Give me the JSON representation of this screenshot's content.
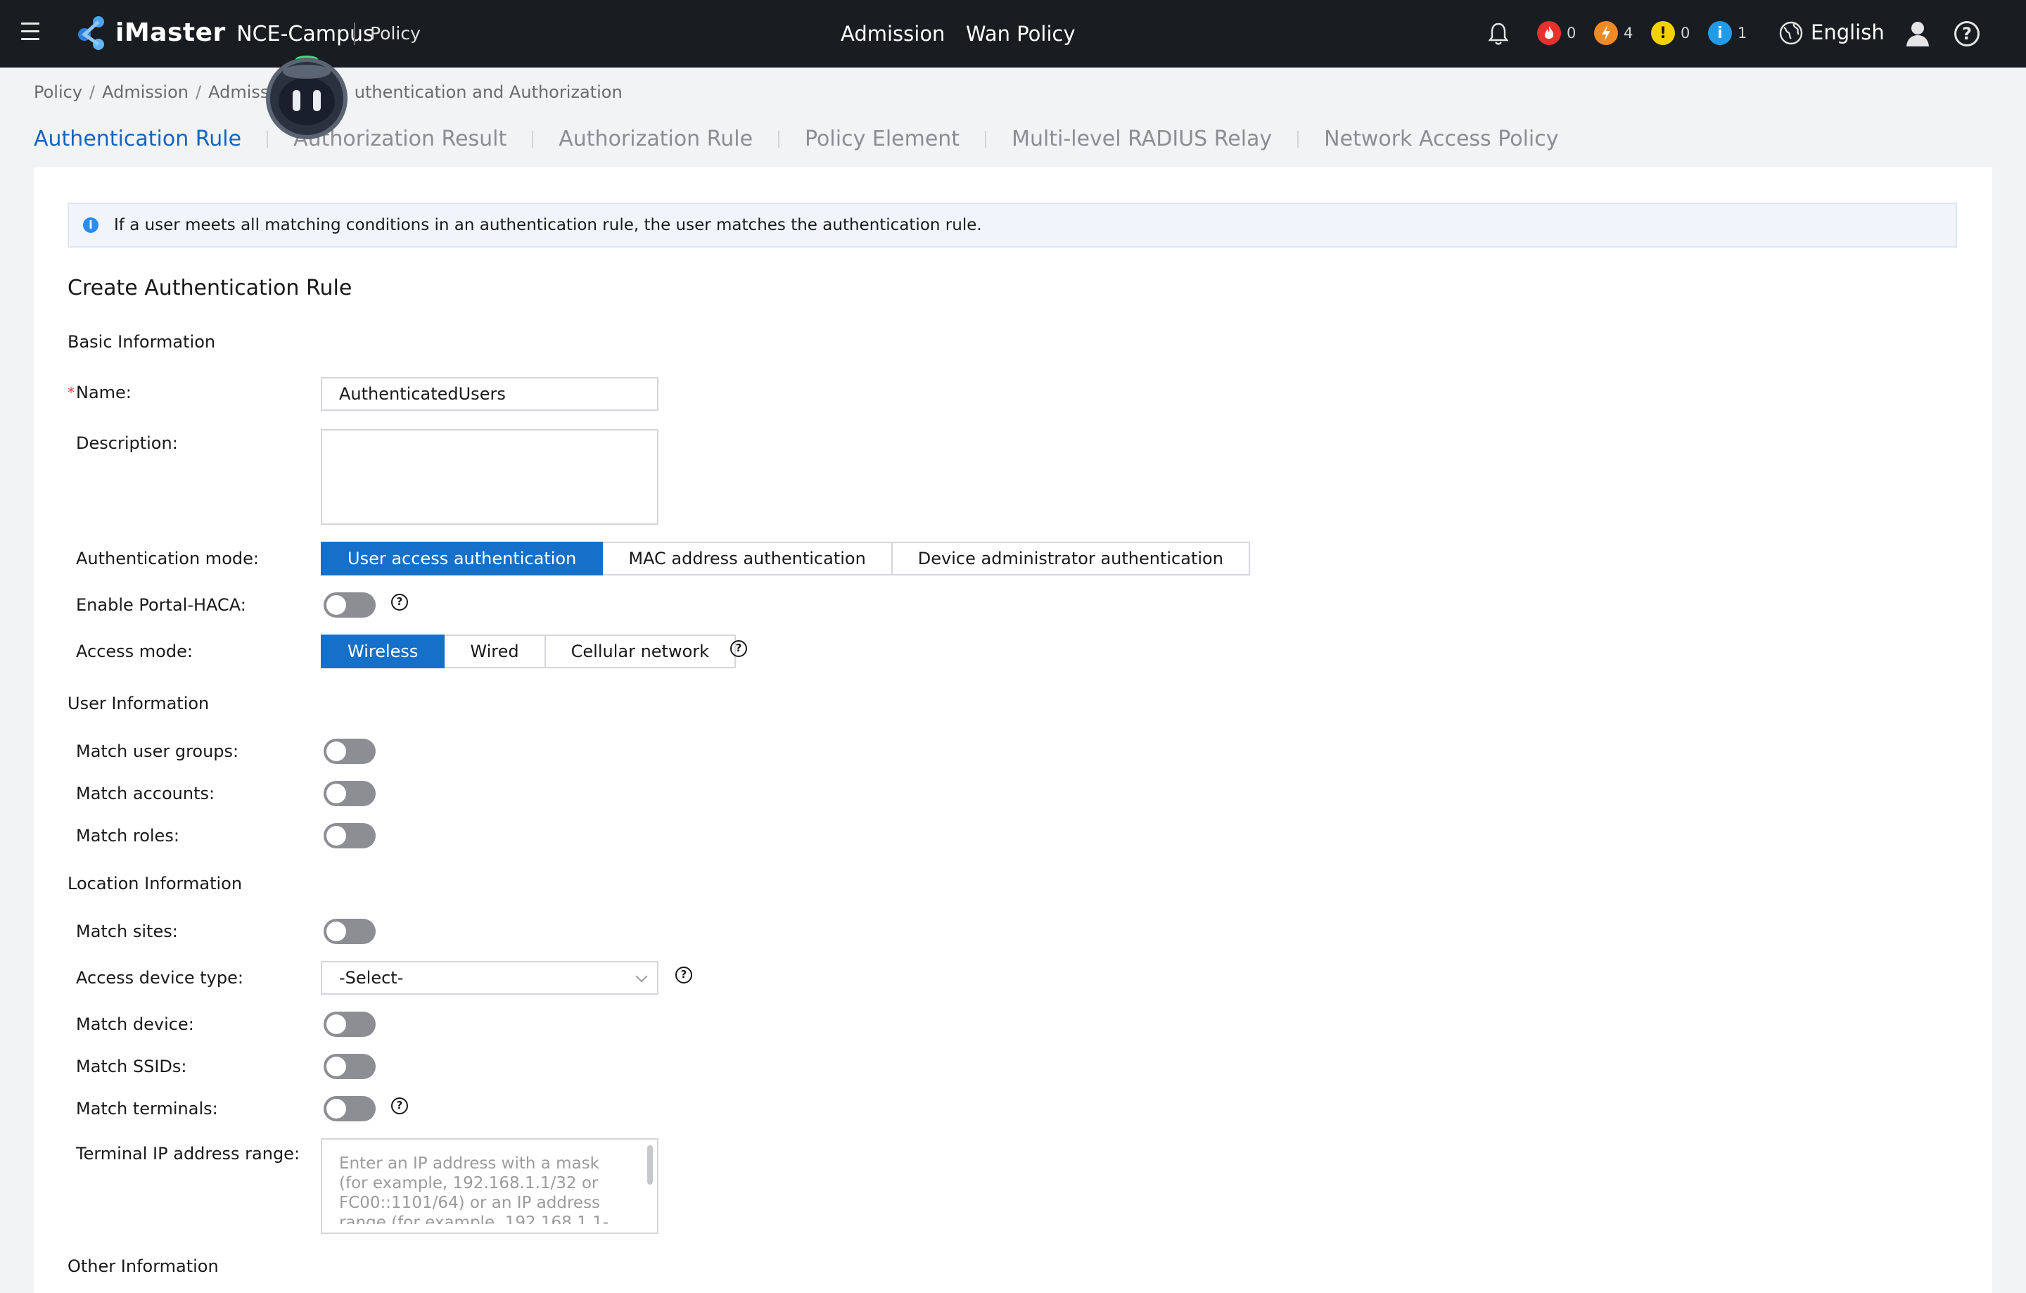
{
  "header": {
    "brand_main": "iMaster",
    "brand_sub": "NCE-Campus",
    "module": "Policy",
    "nav": [
      "Admission",
      "Wan Policy"
    ],
    "alarms": [
      {
        "name": "critical",
        "count": "0",
        "color": "#e5322d"
      },
      {
        "name": "major",
        "count": "4",
        "color": "#f08a24"
      },
      {
        "name": "minor",
        "count": "0",
        "color": "#f5d100"
      },
      {
        "name": "info",
        "count": "1",
        "color": "#1f9be8"
      }
    ],
    "language": "English"
  },
  "breadcrumb": [
    "Policy",
    "Admission",
    "Admissio",
    "uthentication and Authorization"
  ],
  "tabs": [
    "Authentication Rule",
    "Authorization Result",
    "Authorization Rule",
    "Policy Element",
    "Multi-level RADIUS Relay",
    "Network Access Policy"
  ],
  "info_message": "If a user meets all matching conditions in an authentication rule, the user matches the authentication rule.",
  "form": {
    "title": "Create Authentication Rule",
    "basic_section": "Basic Information",
    "name_label": "Name:",
    "name_value": "AuthenticatedUsers",
    "description_label": "Description:",
    "description_value": "",
    "auth_mode_label": "Authentication mode:",
    "auth_modes": [
      "User access authentication",
      "MAC address authentication",
      "Device administrator authentication"
    ],
    "auth_mode_selected": "User access authentication",
    "portal_haca_label": "Enable Portal-HACA:",
    "access_mode_label": "Access mode:",
    "access_modes": [
      "Wireless",
      "Wired",
      "Cellular network"
    ],
    "access_mode_selected": "Wireless",
    "user_section": "User Information",
    "match_user_groups_label": "Match user groups:",
    "match_accounts_label": "Match accounts:",
    "match_roles_label": "Match roles:",
    "location_section": "Location Information",
    "match_sites_label": "Match sites:",
    "access_device_type_label": "Access device type:",
    "access_device_type_value": "-Select-",
    "match_device_label": "Match device:",
    "match_ssids_label": "Match SSIDs:",
    "match_terminals_label": "Match terminals:",
    "terminal_ip_label": "Terminal IP address range:",
    "terminal_ip_placeholder": "Enter an IP address with a mask (for example, 192.168.1.1/32 or FC00::1101/64) or an IP address range (for example, 192.168.1.1-",
    "other_section": "Other Information",
    "toggles": {
      "portal_haca": false,
      "match_user_groups": false,
      "match_accounts": false,
      "match_roles": false,
      "match_sites": false,
      "match_device": false,
      "match_ssids": false,
      "match_terminals": false
    }
  }
}
